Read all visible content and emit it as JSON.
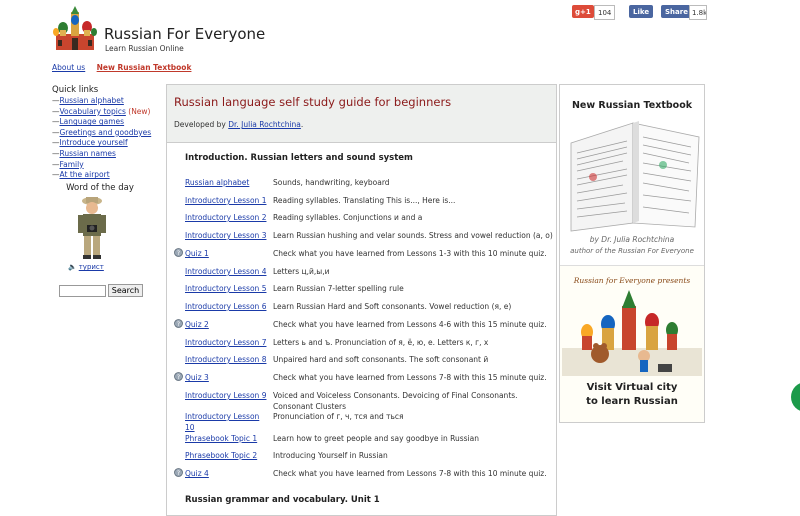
{
  "header": {
    "title": "Russian For Everyone",
    "subtitle": "Learn Russian Online"
  },
  "social": {
    "gplus_label": "g+1",
    "gplus_count": "104",
    "fb_like": "Like",
    "fb_share": "Share",
    "fb_count": "1.8k"
  },
  "topnav": {
    "about": "About us",
    "new_textbook": "New Russian Textbook"
  },
  "sidebar": {
    "quick_links_title": "Quick links",
    "links": [
      {
        "label": "Russian alphabet",
        "suffix": ""
      },
      {
        "label": "Vocabulary topics",
        "suffix": "(New)"
      },
      {
        "label": "Language games",
        "suffix": ""
      },
      {
        "label": "Greetings and goodbyes",
        "suffix": ""
      },
      {
        "label": "Introduce yourself",
        "suffix": ""
      },
      {
        "label": "Russian names",
        "suffix": ""
      },
      {
        "label": "Family",
        "suffix": ""
      },
      {
        "label": "At the airport",
        "suffix": ""
      }
    ],
    "word_of_day_title": "Word of the day",
    "word": "турист",
    "search_button": "Search"
  },
  "main": {
    "title": "Russian language self study guide for beginners",
    "developed_by": "Developed by",
    "author": "Dr. Julia Rochtchina",
    "author_period": ".",
    "section1_title": "Introduction. Russian letters and sound system",
    "section2_title": "Russian grammar and vocabulary. Unit 1",
    "lessons": [
      {
        "link": "Russian alphabet",
        "desc": "Sounds, handwriting, keyboard",
        "quiz": false
      },
      {
        "link": "Introductory Lesson 1",
        "desc": "Reading syllables. Translating This is..., Here is...",
        "quiz": false
      },
      {
        "link": "Introductory Lesson 2",
        "desc": "Reading syllables. Conjunctions и and а",
        "quiz": false
      },
      {
        "link": "Introductory Lesson 3",
        "desc": "Learn Russian hushing and velar sounds. Stress and vowel reduction (а, о)",
        "quiz": false
      },
      {
        "link": "Quiz 1",
        "desc": "Check what you have learned from Lessons 1-3 with this 10 minute quiz.",
        "quiz": true
      },
      {
        "link": "Introductory Lesson 4",
        "desc": "Letters ц,й,ы,и",
        "quiz": false
      },
      {
        "link": "Introductory Lesson 5",
        "desc": "Learn Russian 7-letter spelling rule",
        "quiz": false
      },
      {
        "link": "Introductory Lesson 6",
        "desc": "Learn Russian Hard and Soft consonants. Vowel reduction (я, е)",
        "quiz": false
      },
      {
        "link": "Quiz 2",
        "desc": "Check what you have learned from Lessons 4-6 with this 15 minute quiz.",
        "quiz": true
      },
      {
        "link": "Introductory Lesson 7",
        "desc": "Letters ь and ъ. Pronunciation of я, ё, ю, е. Letters к, г, х",
        "quiz": false
      },
      {
        "link": "Introductory Lesson 8",
        "desc": "Unpaired hard and soft consonants. The soft consonant й",
        "quiz": false
      },
      {
        "link": "Quiz 3",
        "desc": "Check what you have learned from Lessons 7-8 with this 15 minute quiz.",
        "quiz": true
      },
      {
        "link": "Introductory Lesson 9",
        "desc": "Voiced and Voiceless Consonants. Devoicing of Final Consonants. Consonant Clusters",
        "quiz": false
      },
      {
        "link": "Introductory Lesson 10",
        "desc": "Pronunciation of г, ч, тся and ться",
        "quiz": false
      },
      {
        "link": "Phrasebook Topic 1",
        "desc": "Learn how to greet people and say goodbye in Russian",
        "quiz": false
      },
      {
        "link": "Phrasebook Topic 2",
        "desc": "Introducing Yourself in Russian",
        "quiz": false
      },
      {
        "link": "Quiz 4",
        "desc": "Check what you have learned from Lessons 7-8 with this 10 minute quiz.",
        "quiz": true
      }
    ]
  },
  "right": {
    "title": "New Russian Textbook",
    "byline": "by Dr. Julia Rochtchina",
    "byline2": "author of the Russian For Everyone",
    "banner_top": "Russian for Everyone presents",
    "banner_line1": "Visit Virtual city",
    "banner_line2": "to learn Russian"
  },
  "colors": {
    "link": "#1a3aa8",
    "title_red": "#8b1a1a",
    "new_red": "#c0392b",
    "header_bg": "#eef0ee"
  }
}
